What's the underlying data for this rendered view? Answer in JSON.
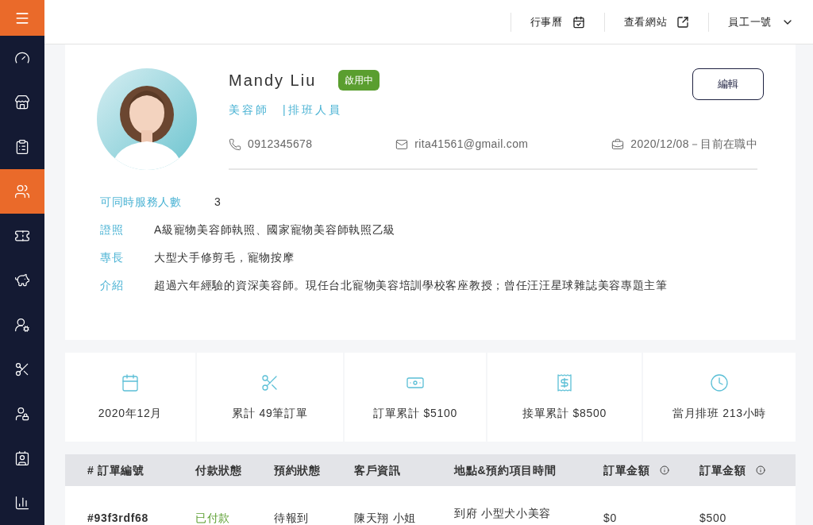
{
  "header": {
    "links": [
      {
        "label": "行事曆",
        "kind": "calendar"
      },
      {
        "label": "查看網站",
        "kind": "external"
      },
      {
        "label": "員工一號",
        "kind": "dropdown"
      }
    ]
  },
  "sidebar": {
    "items": [
      {
        "selected": false
      },
      {
        "selected": false
      },
      {
        "selected": false
      },
      {
        "selected": true
      },
      {
        "selected": false
      },
      {
        "selected": false
      },
      {
        "selected": false
      },
      {
        "selected": false
      },
      {
        "selected": false
      },
      {
        "selected": false
      },
      {
        "selected": false
      }
    ]
  },
  "profile": {
    "name": "Mandy Liu",
    "status": "啟用中",
    "roles": "美容師　|排班人員",
    "edit_button": "編輯",
    "phone": "0912345678",
    "email": "rita41561@gmail.com",
    "employment": "2020/12/08－目前在職中",
    "details": [
      {
        "label": "可同時服務人數",
        "value": "3"
      },
      {
        "label": "證照",
        "value": "A級寵物美容師執照、國家寵物美容師執照乙級"
      },
      {
        "label": "專長",
        "value": "大型犬手修剪毛，寵物按摩"
      },
      {
        "label": "介紹",
        "value": "超過六年經驗的資深美容師。現任台北寵物美容培訓學校客座教授；曾任汪汪星球雜誌美容專題主筆"
      }
    ]
  },
  "stats": [
    {
      "kind": "calendar",
      "label": "2020年12月"
    },
    {
      "kind": "scissors",
      "label": "累計 49筆訂單"
    },
    {
      "kind": "bill",
      "label": "訂單累計 $5100"
    },
    {
      "kind": "invoice",
      "label": "接單累計 $8500"
    },
    {
      "kind": "clock",
      "label": "當月排班 213小時"
    }
  ],
  "table": {
    "columns": [
      {
        "label": "# 訂單編號",
        "info": false
      },
      {
        "label": "付款狀態",
        "info": false
      },
      {
        "label": "預約狀態",
        "info": false
      },
      {
        "label": "客戶資訊",
        "info": false
      },
      {
        "label": "地點&預約項目時間",
        "info": false
      },
      {
        "label": "訂單金額",
        "info": true
      },
      {
        "label": "訂單金額",
        "info": true
      }
    ],
    "rows": [
      {
        "order": "#93f3rdf68",
        "payment": "已付款",
        "paid": true,
        "booking": "待報到",
        "customer": "陳天翔 小姐",
        "service": "到府 小型犬小美容",
        "amount": "$0",
        "total": "$500"
      }
    ]
  }
}
